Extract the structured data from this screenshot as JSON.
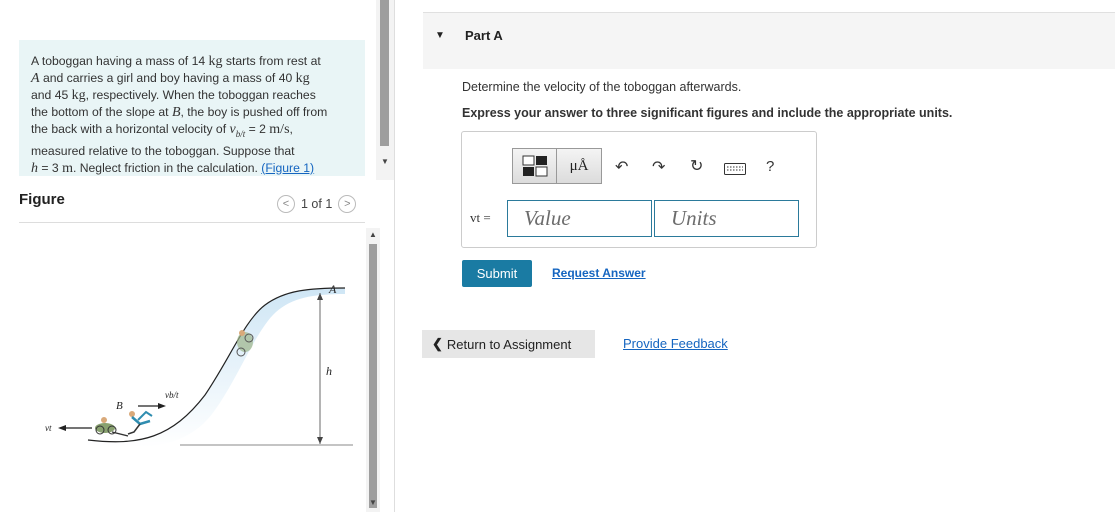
{
  "problem": {
    "lines": [
      "A toboggan having a mass of 14 kg starts from rest at",
      "A and carries a girl and boy having a mass of 40 kg",
      "and 45 kg, respectively. When the toboggan reaches",
      "the bottom of the slope at B, the boy is pushed off from",
      "the back with a horizontal velocity of vb/t = 2 m/s,",
      "measured relative to the toboggan. Suppose that",
      "h = 3 m. Neglect friction in the calculation."
    ],
    "figure_link": "(Figure 1)"
  },
  "figure": {
    "title": "Figure",
    "pager": "1 of 1",
    "labels": {
      "A": "A",
      "B": "B",
      "h": "h",
      "vt": "vt",
      "vbt": "vb/t"
    }
  },
  "part": {
    "title": "Part A",
    "question": "Determine the velocity of the toboggan afterwards.",
    "instruction": "Express your answer to three significant figures and include the appropriate units."
  },
  "answer": {
    "var_label": "vt =",
    "value_placeholder": "Value",
    "units_placeholder": "Units",
    "toolbar": {
      "templates_icon": "templates-icon",
      "units_icon": "μÅ",
      "undo_icon": "undo-icon",
      "redo_icon": "redo-icon",
      "reset_icon": "reset-icon",
      "keyboard_icon": "keyboard-icon",
      "help_label": "?"
    }
  },
  "actions": {
    "submit": "Submit",
    "request": "Request Answer",
    "return": "Return to Assignment",
    "feedback": "Provide Feedback"
  }
}
